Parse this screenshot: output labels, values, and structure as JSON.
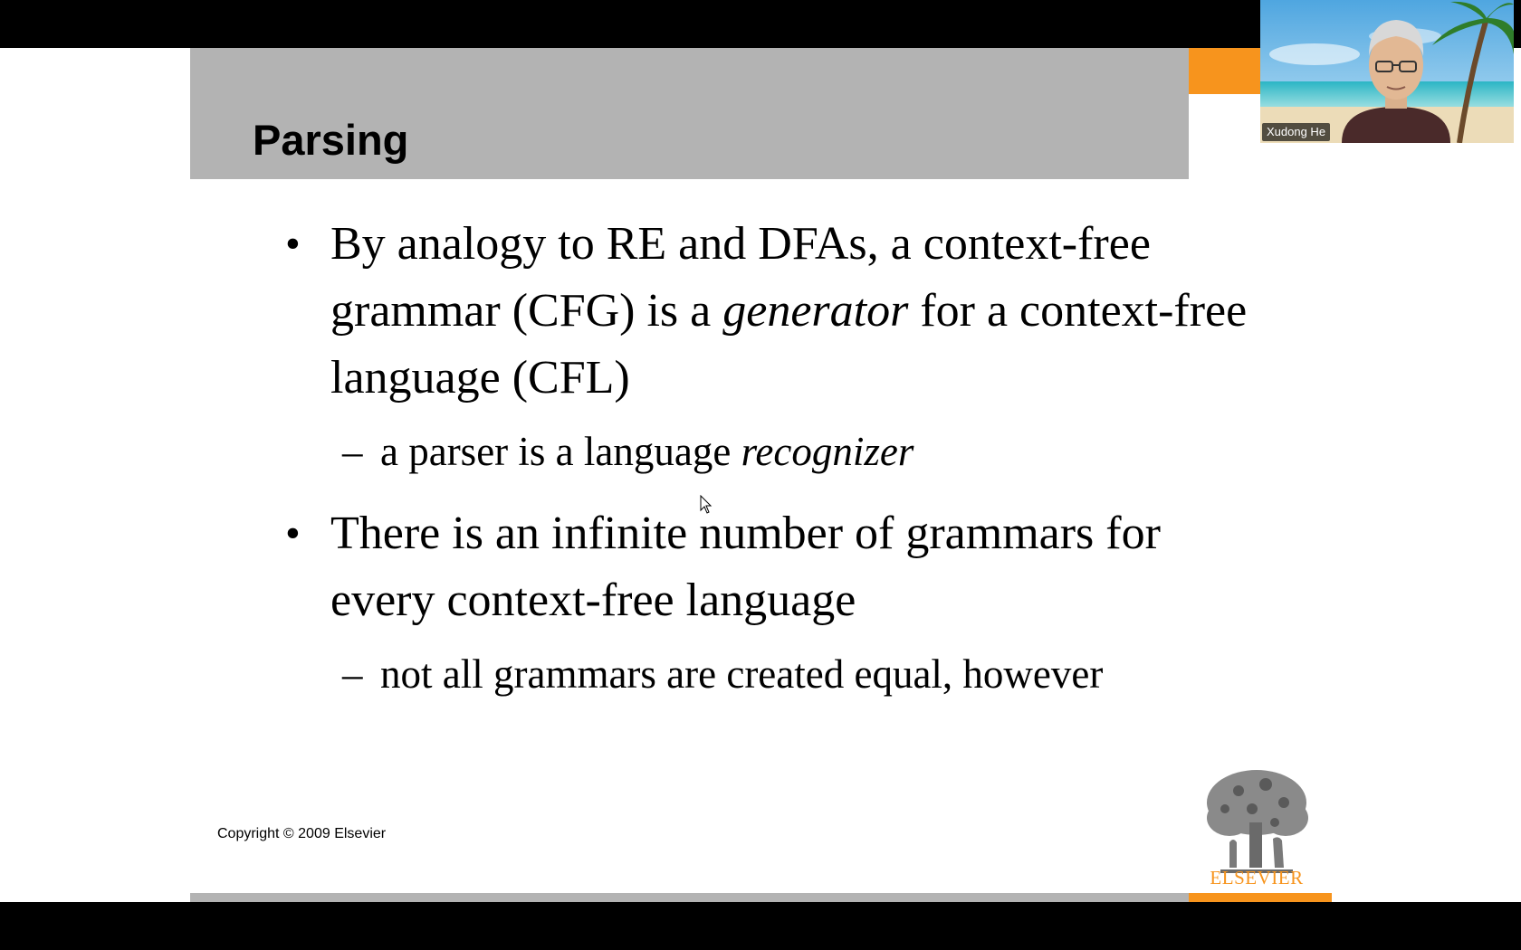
{
  "slide": {
    "title": "Parsing",
    "bullets": [
      {
        "parts": [
          {
            "text": "By analogy to RE and DFAs, a context-free grammar (CFG) is a ",
            "italic": false
          },
          {
            "text": "generator",
            "italic": true
          },
          {
            "text": " for a context-free language (CFL)",
            "italic": false
          }
        ],
        "sub": [
          {
            "parts": [
              {
                "text": "a parser is a language ",
                "italic": false
              },
              {
                "text": "recognizer",
                "italic": true
              }
            ]
          }
        ]
      },
      {
        "parts": [
          {
            "text": "There is an infinite number of grammars for every context-free language",
            "italic": false
          }
        ],
        "sub": [
          {
            "parts": [
              {
                "text": "not all grammars are created equal, however",
                "italic": false
              }
            ]
          }
        ]
      }
    ],
    "copyright": "Copyright © 2009 Elsevier",
    "logo_text": "ELSEVIER",
    "colors": {
      "accent": "#f7941d",
      "title_bar": "#b3b3b3"
    }
  },
  "toolbar": {
    "buttons": [
      {
        "name": "previous-slide-button",
        "icon": "arrow-left-icon",
        "active": false
      },
      {
        "name": "next-slide-button",
        "icon": "arrow-right-icon",
        "active": false
      },
      {
        "name": "pen-button",
        "icon": "pen-icon",
        "active": false
      },
      {
        "name": "see-all-slides-button",
        "icon": "slides-grid-icon",
        "active": false
      },
      {
        "name": "zoom-button",
        "icon": "magnifier-icon",
        "active": false
      },
      {
        "name": "subtitles-button",
        "icon": "subtitles-icon",
        "active": false
      },
      {
        "name": "camera-button",
        "icon": "video-camera-icon",
        "active": true
      },
      {
        "name": "more-options-button",
        "icon": "ellipsis-icon",
        "active": false
      }
    ]
  },
  "video": {
    "participant_name": "Xudong He"
  }
}
